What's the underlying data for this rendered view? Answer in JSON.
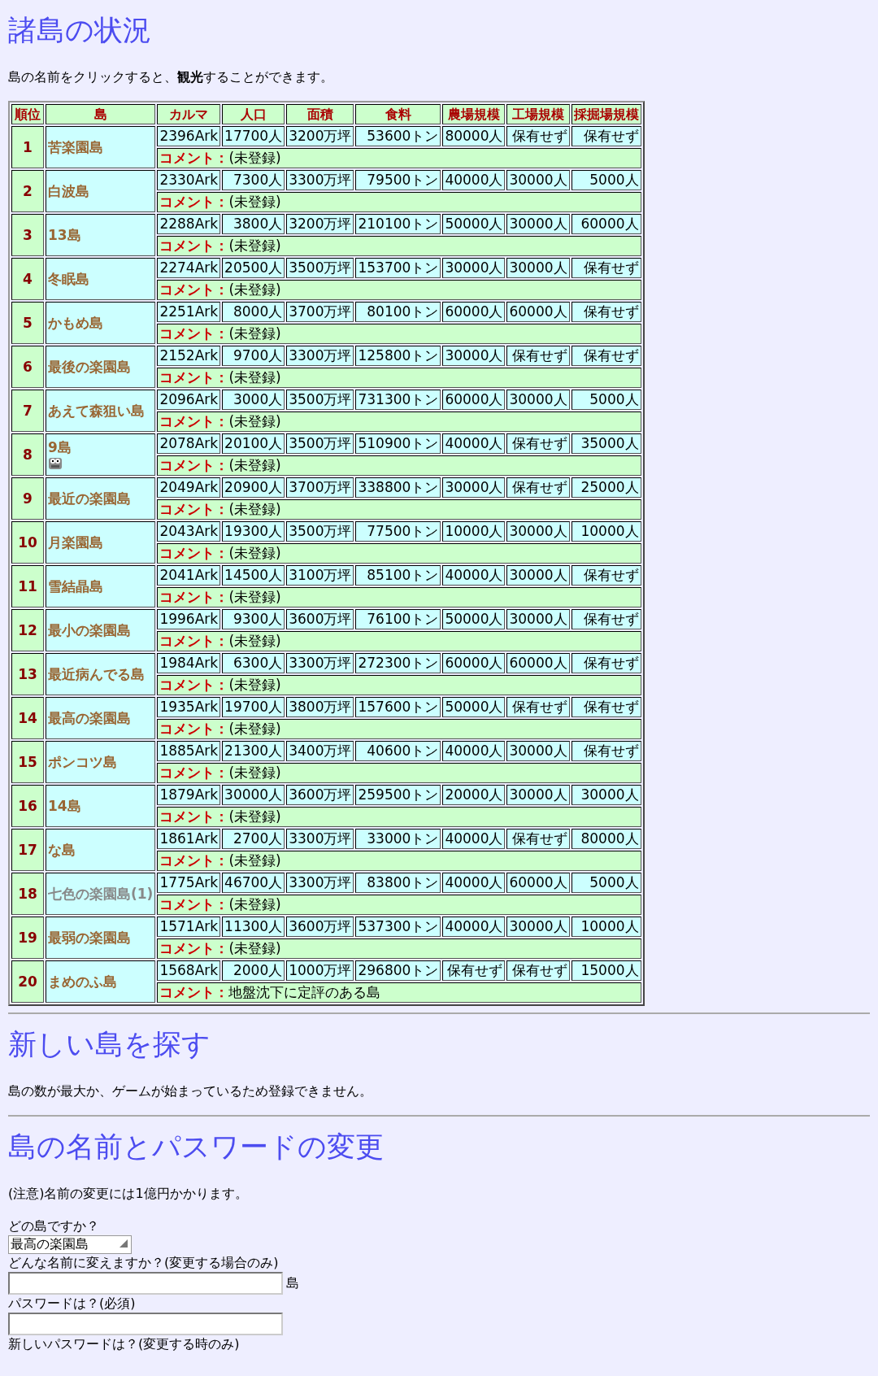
{
  "status": {
    "title": "諸島の状況",
    "intro": "島の名前をクリックすると、**観光**することができます。",
    "columns": [
      "順位",
      "島",
      "カルマ",
      "人口",
      "面積",
      "食料",
      "農場規模",
      "工場規模",
      "採掘場規模"
    ],
    "islands": [
      {
        "rank": "1",
        "name": "苦楽園島",
        "inactive": false,
        "marked": false,
        "karma": "2396Ark",
        "population": "17700人",
        "area": "3200万坪",
        "food": "53600トン",
        "farm": "80000人",
        "factory": "保有せず",
        "mine": "保有せず",
        "comment_label": "コメント：",
        "comment": "(未登録)"
      },
      {
        "rank": "2",
        "name": "白波島",
        "inactive": false,
        "marked": false,
        "karma": "2330Ark",
        "population": "7300人",
        "area": "3300万坪",
        "food": "79500トン",
        "farm": "40000人",
        "factory": "30000人",
        "mine": "5000人",
        "comment_label": "コメント：",
        "comment": "(未登録)"
      },
      {
        "rank": "3",
        "name": "13島",
        "inactive": false,
        "marked": false,
        "karma": "2288Ark",
        "population": "3800人",
        "area": "3200万坪",
        "food": "210100トン",
        "farm": "50000人",
        "factory": "30000人",
        "mine": "60000人",
        "comment_label": "コメント：",
        "comment": "(未登録)"
      },
      {
        "rank": "4",
        "name": "冬眠島",
        "inactive": false,
        "marked": false,
        "karma": "2274Ark",
        "population": "20500人",
        "area": "3500万坪",
        "food": "153700トン",
        "farm": "30000人",
        "factory": "30000人",
        "mine": "保有せず",
        "comment_label": "コメント：",
        "comment": "(未登録)"
      },
      {
        "rank": "5",
        "name": "かもめ島",
        "inactive": false,
        "marked": false,
        "karma": "2251Ark",
        "population": "8000人",
        "area": "3700万坪",
        "food": "80100トン",
        "farm": "60000人",
        "factory": "60000人",
        "mine": "保有せず",
        "comment_label": "コメント：",
        "comment": "(未登録)"
      },
      {
        "rank": "6",
        "name": "最後の楽園島",
        "inactive": false,
        "marked": false,
        "karma": "2152Ark",
        "population": "9700人",
        "area": "3300万坪",
        "food": "125800トン",
        "farm": "30000人",
        "factory": "保有せず",
        "mine": "保有せず",
        "comment_label": "コメント：",
        "comment": "(未登録)"
      },
      {
        "rank": "7",
        "name": "あえて森狙い島",
        "inactive": false,
        "marked": false,
        "karma": "2096Ark",
        "population": "3000人",
        "area": "3500万坪",
        "food": "731300トン",
        "farm": "60000人",
        "factory": "30000人",
        "mine": "5000人",
        "comment_label": "コメント：",
        "comment": "(未登録)"
      },
      {
        "rank": "8",
        "name": "9島",
        "inactive": false,
        "marked": true,
        "karma": "2078Ark",
        "population": "20100人",
        "area": "3500万坪",
        "food": "510900トン",
        "farm": "40000人",
        "factory": "保有せず",
        "mine": "35000人",
        "comment_label": "コメント：",
        "comment": "(未登録)"
      },
      {
        "rank": "9",
        "name": "最近の楽園島",
        "inactive": false,
        "marked": false,
        "karma": "2049Ark",
        "population": "20900人",
        "area": "3700万坪",
        "food": "338800トン",
        "farm": "30000人",
        "factory": "保有せず",
        "mine": "25000人",
        "comment_label": "コメント：",
        "comment": "(未登録)"
      },
      {
        "rank": "10",
        "name": "月楽園島",
        "inactive": false,
        "marked": false,
        "karma": "2043Ark",
        "population": "19300人",
        "area": "3500万坪",
        "food": "77500トン",
        "farm": "10000人",
        "factory": "30000人",
        "mine": "10000人",
        "comment_label": "コメント：",
        "comment": "(未登録)"
      },
      {
        "rank": "11",
        "name": "雪結晶島",
        "inactive": false,
        "marked": false,
        "karma": "2041Ark",
        "population": "14500人",
        "area": "3100万坪",
        "food": "85100トン",
        "farm": "40000人",
        "factory": "30000人",
        "mine": "保有せず",
        "comment_label": "コメント：",
        "comment": "(未登録)"
      },
      {
        "rank": "12",
        "name": "最小の楽園島",
        "inactive": false,
        "marked": false,
        "karma": "1996Ark",
        "population": "9300人",
        "area": "3600万坪",
        "food": "76100トン",
        "farm": "50000人",
        "factory": "30000人",
        "mine": "保有せず",
        "comment_label": "コメント：",
        "comment": "(未登録)"
      },
      {
        "rank": "13",
        "name": "最近病んでる島",
        "inactive": false,
        "marked": false,
        "karma": "1984Ark",
        "population": "6300人",
        "area": "3300万坪",
        "food": "272300トン",
        "farm": "60000人",
        "factory": "60000人",
        "mine": "保有せず",
        "comment_label": "コメント：",
        "comment": "(未登録)"
      },
      {
        "rank": "14",
        "name": "最高の楽園島",
        "inactive": false,
        "marked": false,
        "karma": "1935Ark",
        "population": "19700人",
        "area": "3800万坪",
        "food": "157600トン",
        "farm": "50000人",
        "factory": "保有せず",
        "mine": "保有せず",
        "comment_label": "コメント：",
        "comment": "(未登録)"
      },
      {
        "rank": "15",
        "name": "ポンコツ島",
        "inactive": false,
        "marked": false,
        "karma": "1885Ark",
        "population": "21300人",
        "area": "3400万坪",
        "food": "40600トン",
        "farm": "40000人",
        "factory": "30000人",
        "mine": "保有せず",
        "comment_label": "コメント：",
        "comment": "(未登録)"
      },
      {
        "rank": "16",
        "name": "14島",
        "inactive": false,
        "marked": false,
        "karma": "1879Ark",
        "population": "30000人",
        "area": "3600万坪",
        "food": "259500トン",
        "farm": "20000人",
        "factory": "30000人",
        "mine": "30000人",
        "comment_label": "コメント：",
        "comment": "(未登録)"
      },
      {
        "rank": "17",
        "name": "な島",
        "inactive": false,
        "marked": false,
        "karma": "1861Ark",
        "population": "2700人",
        "area": "3300万坪",
        "food": "33000トン",
        "farm": "40000人",
        "factory": "保有せず",
        "mine": "80000人",
        "comment_label": "コメント：",
        "comment": "(未登録)"
      },
      {
        "rank": "18",
        "name": "七色の楽園島(1)",
        "inactive": true,
        "marked": false,
        "karma": "1775Ark",
        "population": "46700人",
        "area": "3300万坪",
        "food": "83800トン",
        "farm": "40000人",
        "factory": "60000人",
        "mine": "5000人",
        "comment_label": "コメント：",
        "comment": "(未登録)"
      },
      {
        "rank": "19",
        "name": "最弱の楽園島",
        "inactive": false,
        "marked": false,
        "karma": "1571Ark",
        "population": "11300人",
        "area": "3600万坪",
        "food": "537300トン",
        "farm": "40000人",
        "factory": "30000人",
        "mine": "10000人",
        "comment_label": "コメント：",
        "comment": "(未登録)"
      },
      {
        "rank": "20",
        "name": "まめのふ島",
        "inactive": false,
        "marked": false,
        "karma": "1568Ark",
        "population": "2000人",
        "area": "1000万坪",
        "food": "296800トン",
        "farm": "保有せず",
        "factory": "保有せず",
        "mine": "15000人",
        "comment_label": "コメント：",
        "comment": "地盤沈下に定評のある島"
      }
    ]
  },
  "new_island": {
    "title": "新しい島を探す",
    "message": "島の数が最大か、ゲームが始まっているため登録できません。"
  },
  "change": {
    "title": "島の名前とパスワードの変更",
    "note": "(注意)名前の変更には1億円かかります。",
    "island_label": "どの島ですか？",
    "island_value": "最高の楽園島",
    "name_label": "どんな名前に変えますか？(変更する場合のみ)",
    "name_suffix": "島",
    "password_label": "パスワードは？(必須)",
    "new_password_label": "新しいパスワードは？(変更する時のみ)"
  }
}
